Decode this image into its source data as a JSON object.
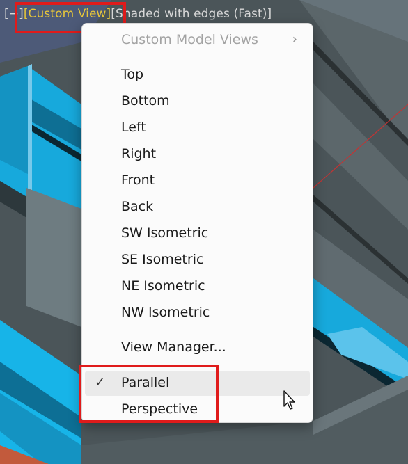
{
  "viewport": {
    "view_cube_toggle": "[−]",
    "view_label": "[Custom View]",
    "visual_style_label": "[Shaded with edges (Fast)]"
  },
  "menu": {
    "submenu_item": "Custom Model Views",
    "views": [
      "Top",
      "Bottom",
      "Left",
      "Right",
      "Front",
      "Back",
      "SW Isometric",
      "SE Isometric",
      "NE Isometric",
      "NW Isometric"
    ],
    "view_manager": "View Manager...",
    "projection": {
      "parallel": "Parallel",
      "perspective": "Perspective",
      "selected": "Parallel"
    }
  },
  "colors": {
    "accent_text": "#e7c63a",
    "highlight_box": "#e01b1b",
    "steel_blue": "#17b4e8"
  },
  "icons": {
    "submenu_arrow": "chevron-right-icon",
    "selected_mark": "checkmark-icon",
    "pointer": "mouse-cursor-icon"
  }
}
